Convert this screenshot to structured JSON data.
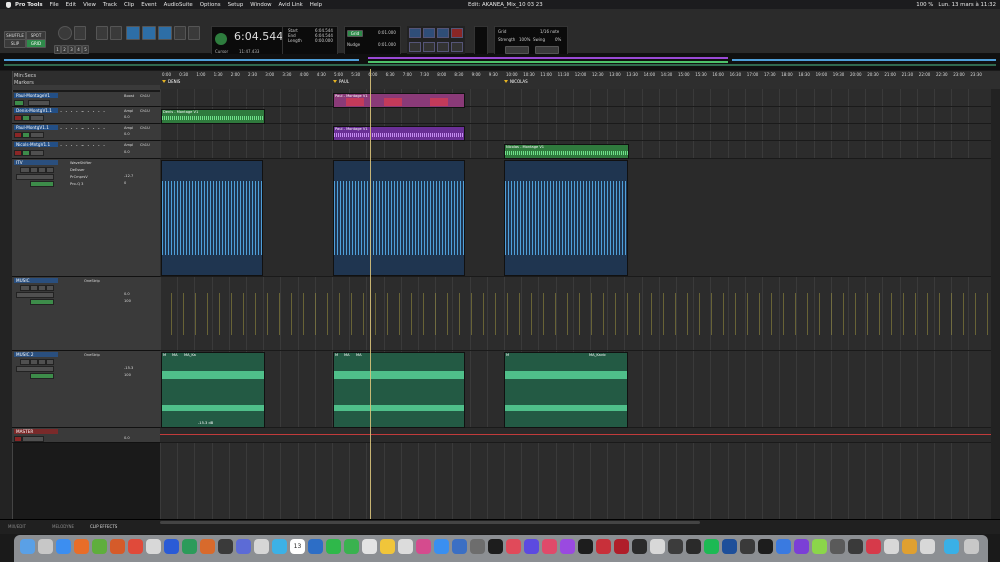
{
  "menubar": {
    "app": "Pro Tools",
    "items": [
      "File",
      "Edit",
      "View",
      "Track",
      "Clip",
      "Event",
      "AudioSuite",
      "Options",
      "Setup",
      "Window",
      "Avid Link",
      "Help"
    ],
    "window_title": "Edit: AKANEA_Mix_10 03 23",
    "battery": "100 %",
    "datetime": "Lun. 13 mars à 11:32"
  },
  "toolbar": {
    "mode_shuffle": "SHUFFLE",
    "mode_spot": "SPOT",
    "mode_slip": "SLIP",
    "mode_grid": "GRID",
    "zoom_presets": [
      "1",
      "2",
      "3",
      "4",
      "5"
    ],
    "main_counter": "6:04.544",
    "cursor_label": "Cursor",
    "cursor_value": "11:47.433",
    "start_label": "Start",
    "end_label": "End",
    "length_label": "Length",
    "start_value": "6:04.544",
    "end_value": "6:04.544",
    "length_value": "0:00.000",
    "grid_label": "Grid",
    "grid_value": "0:01.000",
    "nudge_label": "Nudge",
    "nudge_value": "0:01.000",
    "tempo_grid": "1/16 note",
    "strength_label": "Strength",
    "strength_value": "100%",
    "swing_label": "Swing",
    "swing_value": "0%"
  },
  "edit": {
    "tracklist_label": "Min:Secs",
    "markers_label": "Markers",
    "ruler_ticks": [
      "0:00",
      "0:30",
      "1:00",
      "1:30",
      "2:00",
      "2:30",
      "3:00",
      "3:30",
      "4:00",
      "4:30",
      "5:00",
      "5:30",
      "6:00",
      "6:30",
      "7:00",
      "7:30",
      "8:00",
      "8:30",
      "9:00",
      "9:30",
      "10:00",
      "10:30",
      "11:00",
      "11:30",
      "12:00",
      "12:30",
      "13:00",
      "13:30",
      "14:00",
      "14:30",
      "15:00",
      "15:30",
      "16:00",
      "16:30",
      "17:00",
      "17:30",
      "18:00",
      "18:30",
      "19:00",
      "19:30",
      "20:00",
      "20:30",
      "21:00",
      "21:30",
      "22:00",
      "22:30",
      "23:00",
      "23:30"
    ],
    "markers": [
      "DENIS",
      "PAUL",
      "NICOLAS"
    ]
  },
  "tracks": [
    {
      "name": "Paul-MontageV1",
      "inserts": [
        "Boost",
        "Ch1U"
      ],
      "level": "0.0",
      "clip": "Paul - Montage V1"
    },
    {
      "name": "Denis-MontgV1.1",
      "inserts": [
        "Ampl",
        "Ch1U"
      ],
      "level": "0.0",
      "clip": "Denis - Montage V1"
    },
    {
      "name": "Paul-MontgV1.1",
      "inserts": [
        "Ampl",
        "Ch1U"
      ],
      "level": "0.0",
      "clip": "Paul - Montage V1"
    },
    {
      "name": "Nicols-MntgV1.1",
      "inserts": [
        "Ampl",
        "Ch1U"
      ],
      "level": "0.0",
      "clip": "Nicolas - Montage V1"
    },
    {
      "name": "ITV",
      "inserts": [
        "WaveShifter",
        "DeEsser",
        "PrCmprsV",
        "Pro-Q 3"
      ],
      "vol": "-12.7",
      "pan": "0"
    },
    {
      "name": "MUSIC",
      "inserts": [
        "OneStrip"
      ],
      "vol": "0.0",
      "pan": "100"
    },
    {
      "name": "MUSIC 2",
      "inserts": [
        "OneStrip"
      ],
      "vol": "-15.3",
      "pan": "100"
    },
    {
      "name": "MASTER",
      "vol": "0.0"
    }
  ],
  "music2_clips": [
    "M",
    "MA",
    "MA_Ka",
    "M",
    "MA",
    "MA",
    "M",
    "M",
    "MA",
    "MA_Kr",
    "MA_P",
    "M",
    "MA",
    "MA_Kavic"
  ],
  "music2_levels": [
    "-15.3 dB"
  ],
  "bottom_tabs": [
    "MIX/EDIT",
    "MELODYNE",
    "CLIP EFFECTS"
  ],
  "dock_date": "13",
  "colors": {
    "audio_wave": "#4f9fd9",
    "music2": "#4fbf8a",
    "music_auto": "#d7c94a",
    "denis_clip": "#4ec26a",
    "paul_clip": "#9a4ad6",
    "nicolas_clip": "#4ec26a",
    "paul_video": "#c33a5a"
  }
}
